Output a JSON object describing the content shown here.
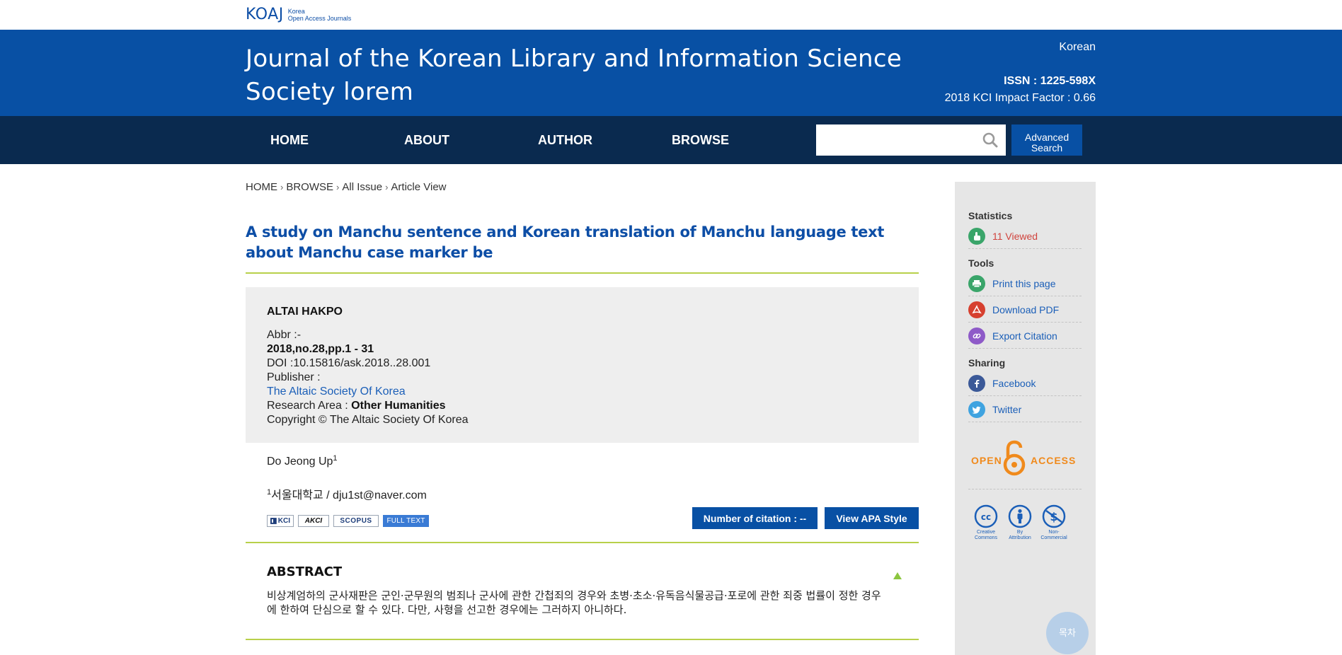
{
  "brand": {
    "logo_text": "KOAJ",
    "logo_sub_1": "Korea",
    "logo_sub_2": "Open Access Journals"
  },
  "header": {
    "journal_title": "Journal of the Korean Library and Information Science Society lorem",
    "language_link": "Korean",
    "issn": "ISSN : 1225-598X",
    "impact_factor": "2018 KCI Impact Factor : 0.66"
  },
  "nav": {
    "items": [
      "HOME",
      "ABOUT",
      "AUTHOR",
      "BROWSE"
    ],
    "search_placeholder": "",
    "advanced_search_line1": "Advanced",
    "advanced_search_line2": "Search"
  },
  "breadcrumb": [
    "HOME",
    "BROWSE",
    "All Issue",
    "Article View"
  ],
  "article": {
    "title": "A study on Manchu sentence and Korean translation of Manchu language text about Manchu case marker be",
    "journal_name": "ALTAI HAKPO",
    "abbr": "Abbr :-",
    "volume": "2018,no.28,pp.1 - 31",
    "doi": "DOI :10.15816/ask.2018..28.001",
    "publisher_label": "Publisher :",
    "publisher_name": "The Altaic Society Of Korea",
    "research_area_label": "Research Area : ",
    "research_area_value": "Other Humanities",
    "copyright": "Copyright © The Altaic Society Of Korea",
    "author_name": "Do Jeong Up",
    "author_sup": "1",
    "affil_sup": "1",
    "affiliation": "서울대학교 / dju1st@naver.com",
    "badges": [
      "KCI",
      "AKCI",
      "SCOPUS",
      "FULL TEXT"
    ],
    "citation_button": "Number of citation : --",
    "apa_button": "View APA Style",
    "abstract_heading": "ABSTRACT",
    "abstract_text": "비상계엄하의 군사재판은 군인·군무원의 범죄나 군사에 관한 간첩죄의 경우와 초병·초소·유독음식물공급·포로에 관한 죄중 법률이 정한 경우에 한하여 단심으로 할 수 있다. 다만, 사형을 선고한 경우에는 그러하지 아니하다."
  },
  "sidebar": {
    "statistics_heading": "Statistics",
    "viewed": "11 Viewed",
    "tools_heading": "Tools",
    "print": "Print this page",
    "download": "Download PDF",
    "export": "Export Citation",
    "sharing_heading": "Sharing",
    "facebook": "Facebook",
    "twitter": "Twitter",
    "open_access_left": "OPEN",
    "open_access_right": "ACCESS",
    "cc_labels": [
      {
        "line1": "Creative",
        "line2": "Commons"
      },
      {
        "line1": "By",
        "line2": "Attribution"
      },
      {
        "line1": "Non-",
        "line2": "Commercial"
      }
    ]
  },
  "toc_button": "목차",
  "colors": {
    "header_blue": "#0850a4",
    "nav_navy": "#0a2a4f",
    "accent_green": "#b8d04a",
    "link_blue": "#1b5fb8",
    "viewed_red": "#d0443e",
    "open_access_orange": "#f08a1c"
  }
}
